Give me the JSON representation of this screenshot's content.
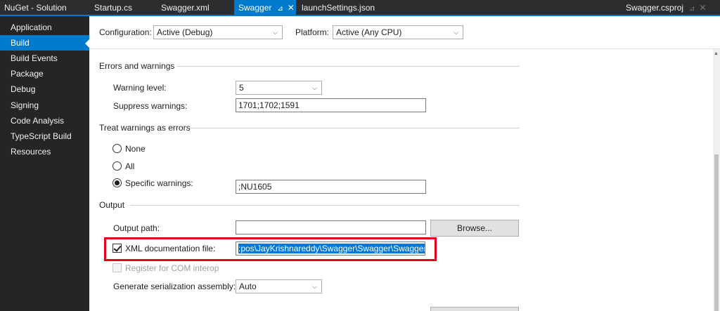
{
  "tabs": [
    {
      "label": "NuGet - Solution",
      "active": false
    },
    {
      "label": "Startup.cs",
      "active": false
    },
    {
      "label": "Swagger.xml",
      "active": false
    },
    {
      "label": "Swagger",
      "active": true,
      "pin": "⊿",
      "close": "✕"
    },
    {
      "label": "launchSettings.json",
      "active": false
    }
  ],
  "project_tab": {
    "label": "Swagger.csproj",
    "pin": "⊿",
    "close": "✕"
  },
  "sidebar": {
    "items": [
      {
        "label": "Application",
        "active": false
      },
      {
        "label": "Build",
        "active": true
      },
      {
        "label": "Build Events",
        "active": false
      },
      {
        "label": "Package",
        "active": false
      },
      {
        "label": "Debug",
        "active": false
      },
      {
        "label": "Signing",
        "active": false
      },
      {
        "label": "Code Analysis",
        "active": false
      },
      {
        "label": "TypeScript Build",
        "active": false
      },
      {
        "label": "Resources",
        "active": false
      }
    ]
  },
  "config": {
    "configuration_label": "Configuration:",
    "configuration_value": "Active (Debug)",
    "platform_label": "Platform:",
    "platform_value": "Active (Any CPU)"
  },
  "errors_section": {
    "title": "Errors and warnings",
    "warning_level_label": "Warning level:",
    "warning_level_value": "5",
    "suppress_label": "Suppress warnings:",
    "suppress_value": "1701;1702;1591"
  },
  "treat_section": {
    "title": "Treat warnings as errors",
    "none_label": "None",
    "all_label": "All",
    "specific_label": "Specific warnings:",
    "specific_value": ";NU1605",
    "selected": "specific"
  },
  "output_section": {
    "title": "Output",
    "output_path_label": "Output path:",
    "output_path_value": "",
    "browse_label": "Browse...",
    "xml_doc_label": "XML documentation file:",
    "xml_doc_checked": true,
    "xml_doc_value": ":pos\\JayKrishnareddy\\Swagger\\Swagger\\Swagger.xml",
    "com_interop_label": "Register for COM interop",
    "com_interop_checked": false,
    "serialization_label": "Generate serialization assembly:",
    "serialization_value": "Auto"
  },
  "colors": {
    "accent": "#007acc",
    "highlight_border": "#e3001b",
    "sidebar_bg": "#252526",
    "tabbar_bg": "#2d2d30"
  }
}
